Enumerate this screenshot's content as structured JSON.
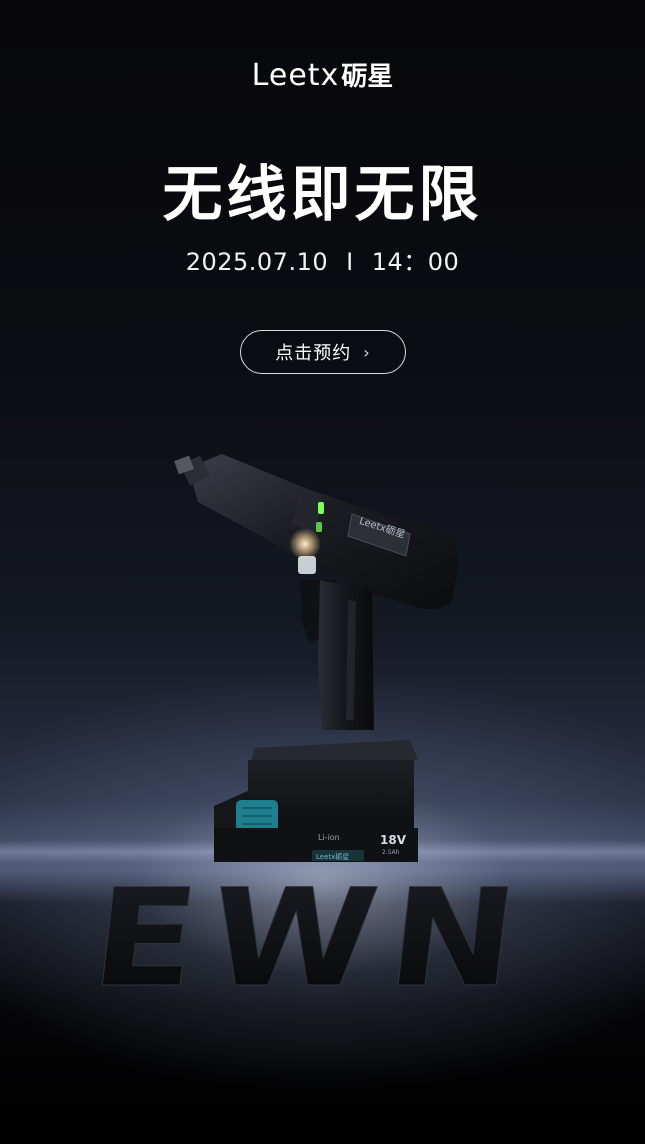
{
  "brand": {
    "latin": "Leetx",
    "cn": "砺星"
  },
  "headline": "无线即无限",
  "event": {
    "date": "2025.07.10",
    "separator": "I",
    "time": "14：00"
  },
  "cta": {
    "label": "点击预约",
    "icon": "chevron-right-icon"
  },
  "product": {
    "body_logo": "Leetx砺星",
    "battery_type": "Li-ion",
    "battery_voltage": "18V",
    "battery_capacity": "2.5Ah",
    "battery_logo": "Leetx砺星",
    "accent_color": "#1f7f8e",
    "indicator_color": "#7dff5a"
  },
  "floor_text": "EWN",
  "colors": {
    "background": "#08080b",
    "text": "#ffffff",
    "horizon_glow": "#c8d2ee"
  }
}
